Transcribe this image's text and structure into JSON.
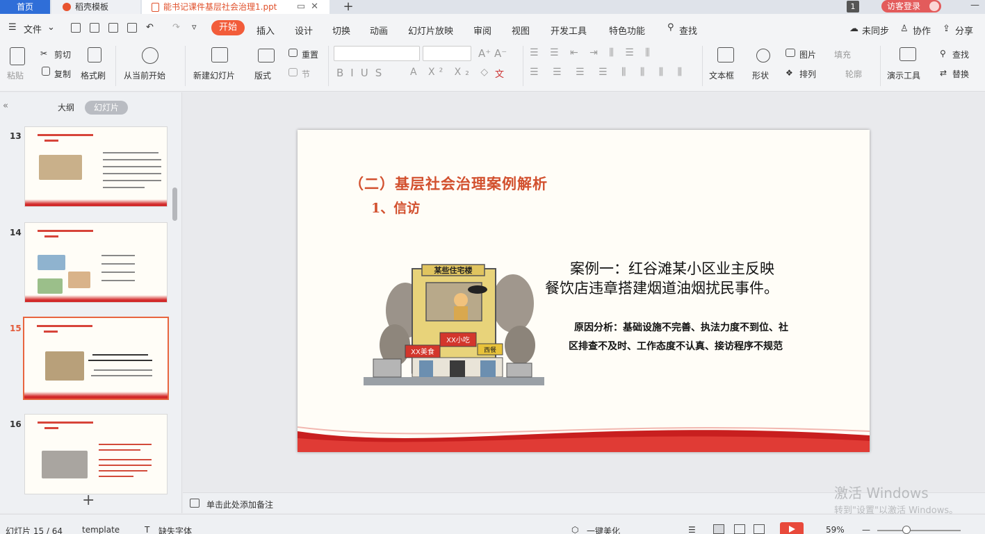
{
  "tabs": {
    "home": "首页",
    "daoke": "稻壳模板",
    "document": "能书记课件基层社会治理1.ppt",
    "badge": "1",
    "login": "访客登录"
  },
  "menu": {
    "file": "文件",
    "items": [
      "开始",
      "插入",
      "设计",
      "切换",
      "动画",
      "幻灯片放映",
      "审阅",
      "视图",
      "开发工具",
      "特色功能"
    ],
    "search": "查找",
    "sync": "未同步",
    "collab": "协作",
    "share": "分享"
  },
  "ribbon": {
    "paste": "粘贴",
    "cut": "剪切",
    "copy": "复制",
    "format_painter": "格式刷",
    "from_current": "从当前开始",
    "new_slide": "新建幻灯片",
    "layout": "版式",
    "reset": "重置",
    "section": "节",
    "textbox": "文本框",
    "shape": "形状",
    "picture": "图片",
    "fill": "填充",
    "arrange": "排列",
    "outline": "轮廓",
    "present_tools": "演示工具",
    "find": "查找",
    "replace": "替换"
  },
  "left_panel": {
    "tab_outline": "大纲",
    "tab_slides": "幻灯片",
    "slides": [
      {
        "num": "13",
        "active": false
      },
      {
        "num": "14",
        "active": false
      },
      {
        "num": "15",
        "active": true
      },
      {
        "num": "16",
        "active": false
      }
    ]
  },
  "slide": {
    "title": "（二）基层社会治理案例解析",
    "subtitle": "1、信访",
    "case_line1": "案例一：红谷滩某小区业主反映",
    "case_line2": "餐饮店违章搭建烟道油烟扰民事件。",
    "reason_line1": "原因分析：基础设施不完善、执法力度不到位、社",
    "reason_line2": "区排查不及时、工作态度不认真、接访程序不规范",
    "illus_sign": "某些住宅楼",
    "shop1": "XX美食",
    "shop2": "XX小吃",
    "shop3": "西餐"
  },
  "notes": {
    "placeholder": "单击此处添加备注"
  },
  "watermark": {
    "title": "激活 Windows",
    "sub": "转到\"设置\"以激活 Windows。"
  },
  "status": {
    "slide_count": "幻灯片 15 / 64",
    "template": "template",
    "missing_font": "缺失字体",
    "beautify": "一键美化",
    "zoom": "59%"
  },
  "colors": {
    "accent": "#f25c3a",
    "title_red": "#d2502e",
    "wave_red": "#d22a2a"
  }
}
